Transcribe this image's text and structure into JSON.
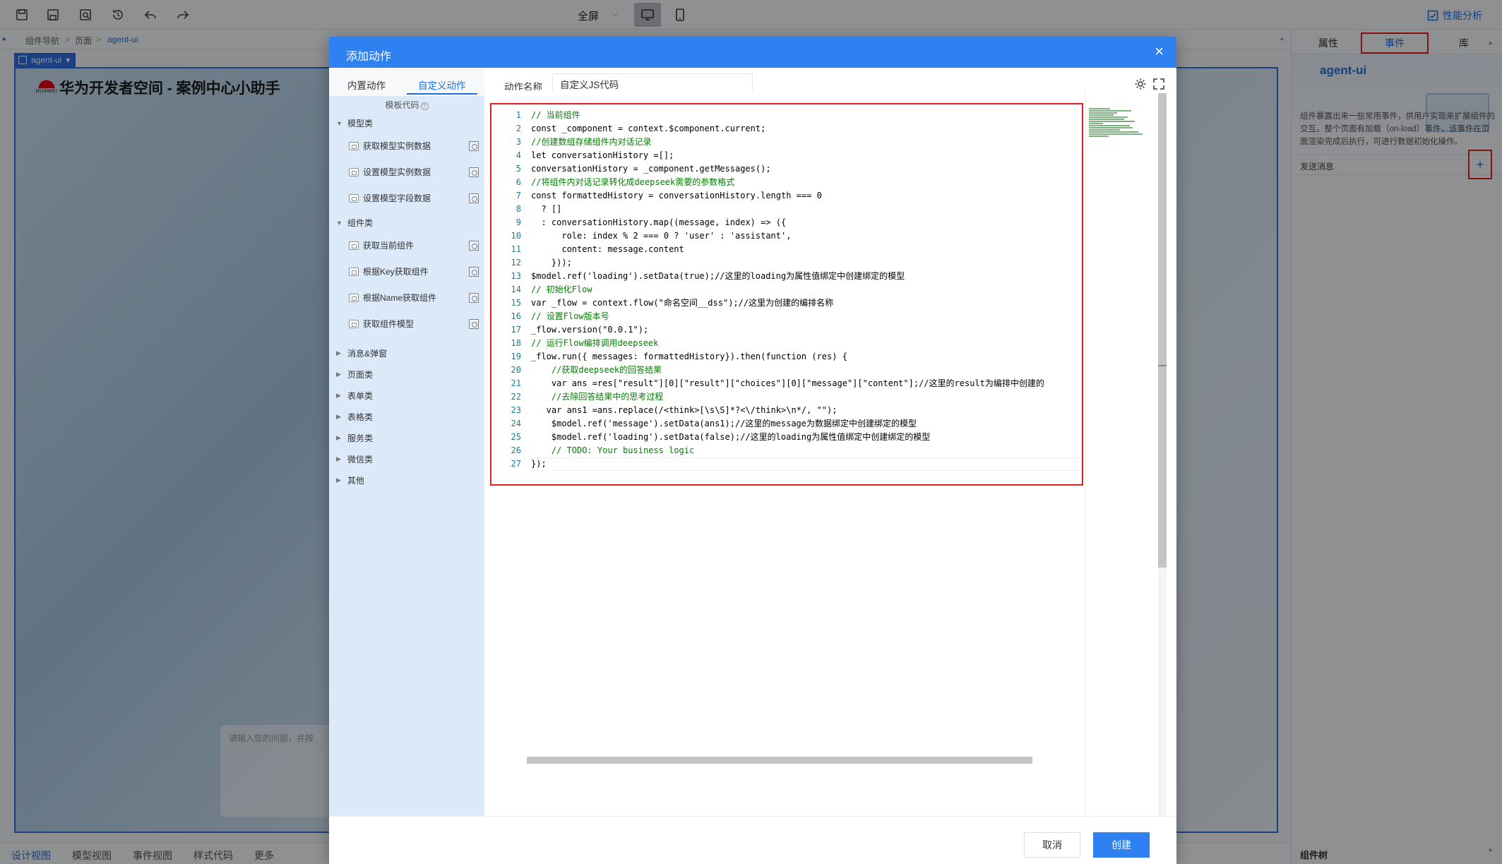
{
  "toolbar": {
    "fullscreen_label": "全屏",
    "perf_label": "性能分析"
  },
  "breadcrumb": {
    "items": [
      "组件导航",
      "页面",
      "agent-ui"
    ]
  },
  "canvas": {
    "tag": "agent-ui",
    "logo_text": "HUAWEI",
    "title": "华为开发者空间 - 案例中心小助手",
    "chat_placeholder": "请输入您的问题，并按"
  },
  "bottom_tabs": [
    "设计视图",
    "模型视图",
    "事件视图",
    "样式代码",
    "更多"
  ],
  "right_panel": {
    "tabs": [
      "属性",
      "事件",
      "库"
    ],
    "card_title": "agent-ui",
    "description": "组件暴露出来一些常用事件，供用户实现来扩展组件的交互。整个页面有加载（on-load）事件，该事件在页面渲染完成后执行，可进行数据初始化操作。",
    "event_label": "发送消息",
    "plus": "+",
    "tree_label": "组件树"
  },
  "modal": {
    "title": "添加动作",
    "close": "×",
    "tabs": [
      "内置动作",
      "自定义动作"
    ],
    "template_label": "模板代码",
    "help_icon": "?",
    "categories": [
      {
        "label": "模型类",
        "expanded": true,
        "items": [
          "获取模型实例数据",
          "设置模型实例数据",
          "设置模型字段数据"
        ]
      },
      {
        "label": "组件类",
        "expanded": true,
        "items": [
          "获取当前组件",
          "根据Key获取组件",
          "根据Name获取组件",
          "获取组件模型"
        ]
      },
      {
        "label": "消息&弹窗",
        "expanded": false,
        "items": []
      },
      {
        "label": "页面类",
        "expanded": false,
        "items": []
      },
      {
        "label": "表单类",
        "expanded": false,
        "items": []
      },
      {
        "label": "表格类",
        "expanded": false,
        "items": []
      },
      {
        "label": "服务类",
        "expanded": false,
        "items": []
      },
      {
        "label": "微信类",
        "expanded": false,
        "items": []
      },
      {
        "label": "其他",
        "expanded": false,
        "items": []
      }
    ],
    "action_name_label": "动作名称",
    "action_name_value": "自定义JS代码",
    "code_lines": [
      "// 当前组件",
      "const _component = context.$component.current;",
      "//创建数组存储组件内对话记录",
      "let conversationHistory =[];",
      "conversationHistory = _component.getMessages();",
      "//将组件内对话记录转化成deepseek需要的参数格式",
      "const formattedHistory = conversationHistory.length === 0",
      "  ? []",
      "  : conversationHistory.map((message, index) => ({",
      "      role: index % 2 === 0 ? 'user' : 'assistant',",
      "      content: message.content",
      "    }));",
      "$model.ref('loading').setData(true);//这里的loading为属性值绑定中创建绑定的模型",
      "// 初始化Flow",
      "var _flow = context.flow(\"命名空间__dss\");//这里为创建的编排名称",
      "// 设置Flow版本号",
      "_flow.version(\"0.0.1\");",
      "// 运行Flow编排调用deepseek",
      "_flow.run({ messages: formattedHistory}).then(function (res) {",
      "    //获取deepseek的回答结果",
      "    var ans =res[\"result\"][0][\"result\"][\"choices\"][0][\"message\"][\"content\"];//这里的result为编排中创建的",
      "    //去除回答结果中的思考过程",
      "   var ans1 =ans.replace(/<think>[\\s\\S]*?<\\/think>\\n*/, \"\");",
      "    $model.ref('message').setData(ans1);//这里的message为数据绑定中创建绑定的模型",
      "    $model.ref('loading').setData(false);//这里的loading为属性值绑定中创建绑定的模型",
      "    // TODO: Your business logic",
      "});"
    ],
    "cancel_label": "取消",
    "create_label": "创建"
  },
  "colors": {
    "accent": "#2f80f0",
    "highlight_border": "#e02020"
  }
}
